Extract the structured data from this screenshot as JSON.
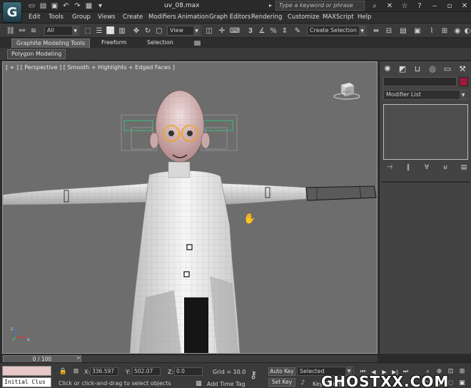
{
  "window": {
    "title": "uv_08.max"
  },
  "search": {
    "placeholder": "Type a keyword or phrase"
  },
  "menu": [
    "Edit",
    "Tools",
    "Group",
    "Views",
    "Create",
    "Modifiers",
    "Animation",
    "Graph Editors",
    "Rendering",
    "Customize",
    "MAXScript",
    "Help"
  ],
  "toolbar": {
    "selection_filter": "All",
    "ref_coord": "View",
    "named_selection": "Create Selection Se"
  },
  "ribbon": {
    "tabs": [
      "Graphite Modeling Tools",
      "Freeform",
      "Selection"
    ],
    "active_tab": 0,
    "panel": "Polygon Modeling"
  },
  "viewport": {
    "label": "[ + ] [ Perspective ] [ Smooth + Highlights + Edged Faces ]",
    "viewcube_label": "FRONT"
  },
  "command_panel": {
    "modifier_list": "Modifier List",
    "object_color": "#9a1a3a"
  },
  "timeline": {
    "frame": "0 / 100"
  },
  "status": {
    "maxscript_listener": "Initial Clus",
    "prompt": "Click or click-and-drag to select objects",
    "x_label": "X:",
    "x": "336.597",
    "y_label": "Y:",
    "y": "502.07",
    "z_label": "Z:",
    "z": "0.0",
    "grid": "Grid = 10.0",
    "add_time_tag": "Add Time Tag",
    "auto_key": "Auto Key",
    "set_key": "Set Key",
    "key_mode": "Selected",
    "key_filters": "Key Filters..."
  },
  "watermark": "GHOSTXX.COM",
  "icons": {
    "app": "3ds-max-logo",
    "quick_access": [
      "new-file-icon",
      "open-file-icon",
      "save-icon",
      "undo-icon",
      "redo-icon",
      "project-folder-icon",
      "dropdown-icon"
    ]
  }
}
